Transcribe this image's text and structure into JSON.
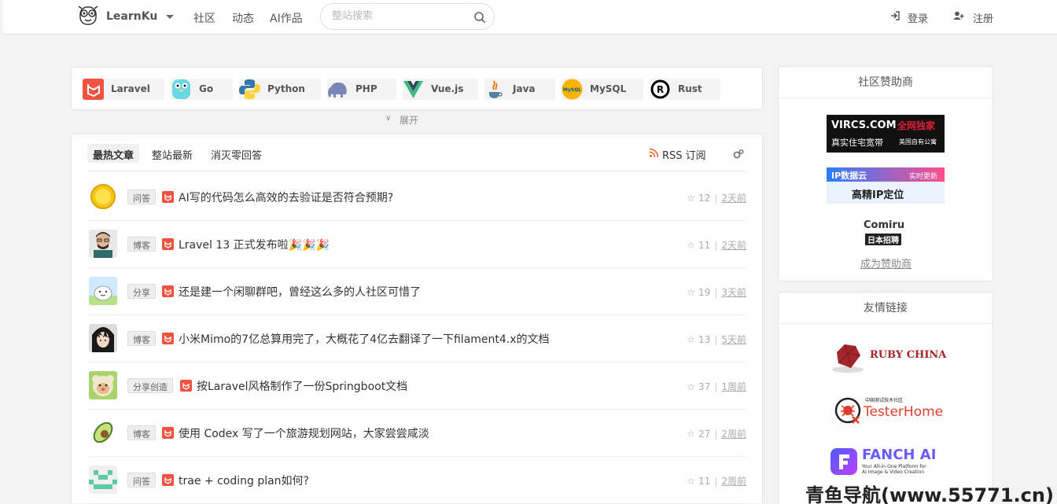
{
  "header": {
    "brand": "LearnKu",
    "nav": [
      "社区",
      "动态",
      "AI作品"
    ],
    "search_placeholder": "整站搜索",
    "login": "登录",
    "register": "注册"
  },
  "categories": [
    "Laravel",
    "Go",
    "Python",
    "PHP",
    "Vue.js",
    "Java",
    "MySQL",
    "Rust"
  ],
  "expand_label": "展开",
  "feed": {
    "tabs": [
      "最热文章",
      "整站最新",
      "消灭零回答"
    ],
    "rss_label": "RSS 订阅",
    "items": [
      {
        "tag": "问答",
        "title": "AI写的代码怎么高效的去验证是否符合预期?",
        "stars": "12",
        "time": "2天前"
      },
      {
        "tag": "博客",
        "title": "Lravel 13 正式发布啦🎉🎉🎉",
        "stars": "11",
        "time": "2天前"
      },
      {
        "tag": "分享",
        "title": "还是建一个闲聊群吧，曾经这么多的人社区可惜了",
        "stars": "19",
        "time": "3天前"
      },
      {
        "tag": "博客",
        "title": "小米Mimo的7亿总算用完了，大概花了4亿去翻译了一下filament4.x的文档",
        "stars": "13",
        "time": "5天前"
      },
      {
        "tag": "分享创造",
        "title": "按Laravel风格制作了一份Springboot文档",
        "stars": "37",
        "time": "1周前"
      },
      {
        "tag": "博客",
        "title": "使用 Codex 写了一个旅游规划网站，大家尝尝咸淡",
        "stars": "27",
        "time": "2周前"
      },
      {
        "tag": "问答",
        "title": "trae + coding plan如何?",
        "stars": "11",
        "time": "2周前"
      }
    ]
  },
  "sidebar": {
    "sponsor_title": "社区赞助商",
    "sponsors": {
      "vircs_line1": "VIRCS.COM",
      "vircs_tag": "全网独家",
      "vircs_line2": "真实住宅宽带",
      "vircs_line3": "美国自有公寓",
      "ip_line1": "IP数据云",
      "ip_tag": "实时更新",
      "ip_line2": "高精IP定位",
      "comiru_line1": "Comiru",
      "comiru_line2": "日本招聘"
    },
    "become_sponsor": "成为赞助商",
    "friends_title": "友情链接",
    "friends": {
      "ruby": "RUBY CHINA",
      "testerhome_small": "中国测试技术社区",
      "testerhome": "TesterHome",
      "fanch": "FANCH AI",
      "fanch_sub1": "Your All-in-One Platform for",
      "fanch_sub2": "AI Image & Video Creation"
    }
  },
  "watermark": "青鱼导航(www.55771.cn)"
}
